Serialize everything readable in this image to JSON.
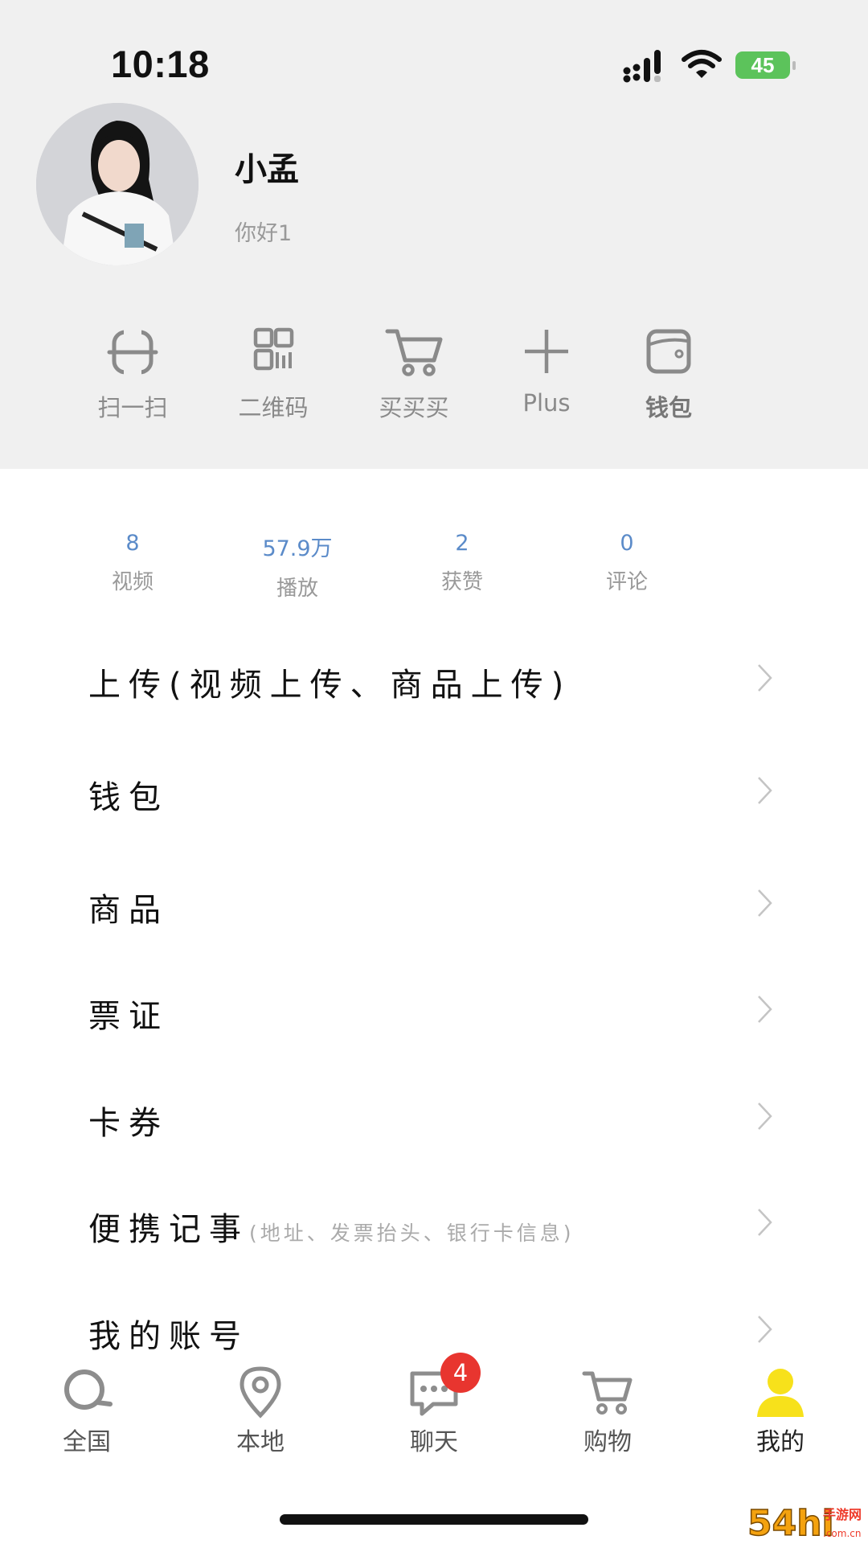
{
  "status_bar": {
    "time": "10:18",
    "battery": "45"
  },
  "profile": {
    "name": "小孟",
    "signature": "你好1"
  },
  "quick_actions": [
    {
      "label": "扫一扫",
      "icon": "scan-icon"
    },
    {
      "label": "二维码",
      "icon": "qr-code-icon"
    },
    {
      "label": "买买买",
      "icon": "cart-icon"
    },
    {
      "label": "Plus",
      "icon": "plus-icon"
    },
    {
      "label": "钱包",
      "icon": "wallet-icon"
    }
  ],
  "stats": [
    {
      "value": "8",
      "label": "视频"
    },
    {
      "value": "57.9万",
      "label": "播放"
    },
    {
      "value": "2",
      "label": "获赞"
    },
    {
      "value": "0",
      "label": "评论"
    }
  ],
  "menu": [
    {
      "label": "上传(视频上传、商品上传)"
    },
    {
      "label": "钱包"
    },
    {
      "label": "商品"
    },
    {
      "label": "票证"
    },
    {
      "label": "卡券"
    },
    {
      "label": "便携记事",
      "note": "(地址、发票抬头、银行卡信息)"
    },
    {
      "label": "我的账号"
    }
  ],
  "tabs": [
    {
      "label": "全国",
      "icon": "search-icon"
    },
    {
      "label": "本地",
      "icon": "location-pin-icon"
    },
    {
      "label": "聊天",
      "icon": "chat-bubble-icon",
      "badge": "4"
    },
    {
      "label": "购物",
      "icon": "cart-icon"
    },
    {
      "label": "我的",
      "icon": "person-icon",
      "active": true
    }
  ],
  "colors": {
    "header_bg": "#f0f0f0",
    "stat_number": "#5b8bc9",
    "badge": "#e8352f",
    "active_tab_icon": "#f7e11b",
    "battery": "#5cc35b"
  },
  "watermark": "54hi 手游网 .com.cn"
}
